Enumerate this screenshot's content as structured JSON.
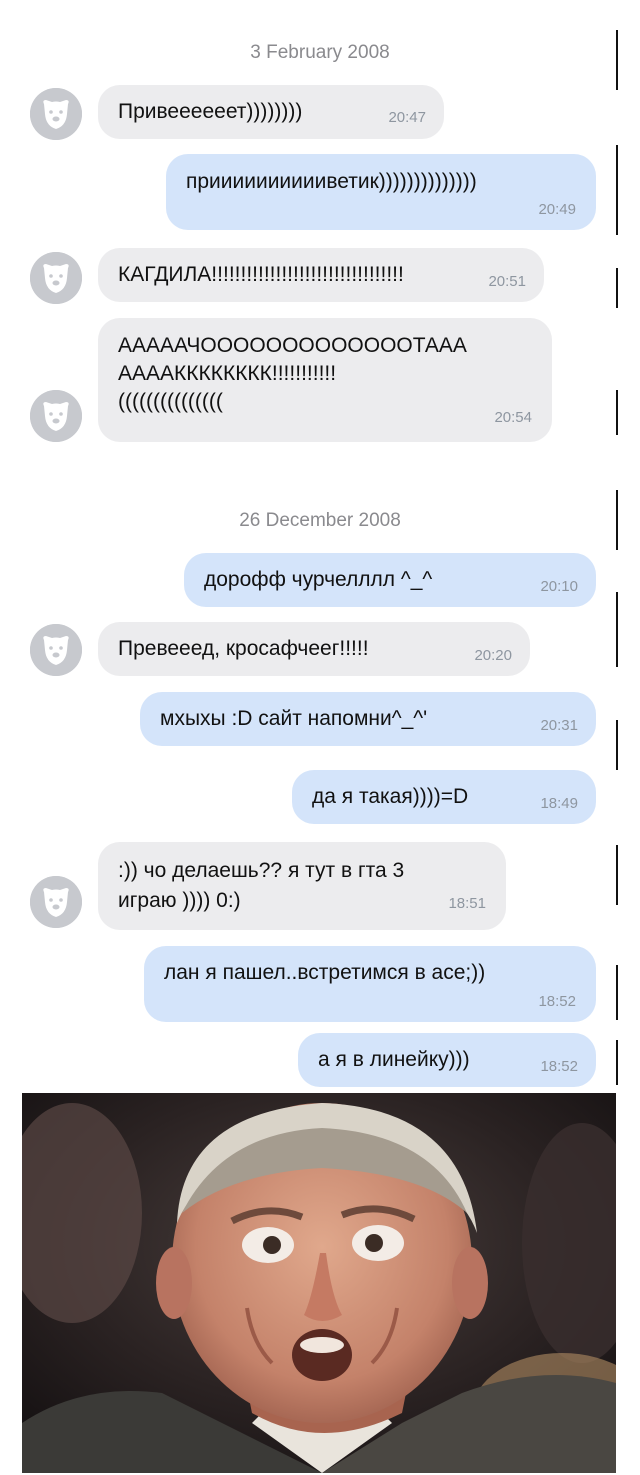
{
  "chat": {
    "date_1": "3 February 2008",
    "date_2": "26 December 2008",
    "messages": [
      {
        "dir": "in",
        "text": "Привееееeет))))))))",
        "time": "20:47"
      },
      {
        "dir": "out",
        "text": "прииииииииииветик))))))))))))))",
        "time": "20:49"
      },
      {
        "dir": "in",
        "text": "КАГДИЛА!!!!!!!!!!!!!!!!!!!!!!!!!!!!!!!!!",
        "time": "20:51"
      },
      {
        "dir": "in",
        "lines": [
          "АААААЧОООООООООООООТААА",
          "ААААКККККККК!!!!!!!!!!!",
          "((((((((((((((("
        ],
        "time": "20:54"
      },
      {
        "dir": "out",
        "text": "дорофф чурчелллл ^_^",
        "time": "20:10"
      },
      {
        "dir": "in",
        "text": "Превееед, кросафчеег!!!!!",
        "time": "20:20"
      },
      {
        "dir": "out",
        "text": "мхыхы :D сайт напомни^_^'",
        "time": "20:31"
      },
      {
        "dir": "out",
        "text": "да я такая))))=D",
        "time": "18:49"
      },
      {
        "dir": "in",
        "lines": [
          ":)) чо делаешь?? я тут в гта 3",
          "играю )))) 0:)"
        ],
        "time": "18:51"
      },
      {
        "dir": "out",
        "text": "лан я пашел..встретимся в асе;))",
        "time": "18:52"
      },
      {
        "dir": "out",
        "text": "а я в линейку)))",
        "time": "18:52"
      }
    ]
  },
  "icons": {
    "avatar": "dog-avatar-icon"
  },
  "colors": {
    "incoming_bubble": "#ececee",
    "outgoing_bubble": "#d4e4fa",
    "timestamp": "#8e96a0",
    "date_separator": "#8a8a8e",
    "avatar_bg": "#c7c9ce"
  }
}
